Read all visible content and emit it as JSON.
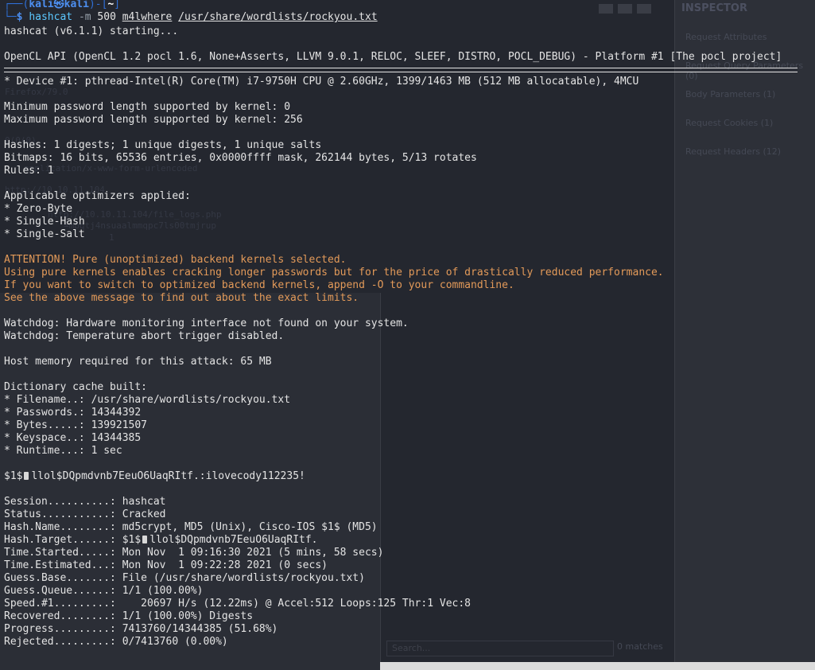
{
  "background_app": {
    "inspector_title": "INSPECTOR",
    "inspector_items": [
      "Request Attributes",
      "Request Query Parameters (0)",
      "Body Parameters (1)",
      "Request Cookies (1)",
      "Request Headers (12)"
    ],
    "ghost_lines": [
      "Firefox/79.0",
      "0(0(0)",
      "application/x-www-form-urlencoded",
      "http://10.10.11.104",
      "http://10.10.11.104/file_logs.php",
      "=mbqtj4nsuaalmmqpc7ls00tmjrup",
      "1"
    ],
    "search_placeholder": "Search...",
    "matches_label": "0 matches"
  },
  "prompt": {
    "frame_top": "┌──(",
    "user": "kali㉿kali",
    "close": ")-[",
    "dir": "~",
    "close2": "]",
    "frame_bottom": "└─",
    "symbol": "$",
    "command": "hashcat",
    "flag": "-m",
    "mode": "500",
    "hash_file": "m4lwhere",
    "wordlist": "/usr/share/wordlists/rockyou.txt"
  },
  "output": {
    "starting": "hashcat (v6.1.1) starting...",
    "opencl": "OpenCL API (OpenCL 1.2 pocl 1.6, None+Asserts, LLVM 9.0.1, RELOC, SLEEF, DISTRO, POCL_DEBUG) - Platform #1 [The pocl project]",
    "device": "* Device #1: pthread-Intel(R) Core(TM) i7-9750H CPU @ 2.60GHz, 1399/1463 MB (512 MB allocatable), 4MCU",
    "min_pw": "Minimum password length supported by kernel: 0",
    "max_pw": "Maximum password length supported by kernel: 256",
    "hashes": "Hashes: 1 digests; 1 unique digests, 1 unique salts",
    "bitmaps": "Bitmaps: 16 bits, 65536 entries, 0x0000ffff mask, 262144 bytes, 5/13 rotates",
    "rules": "Rules: 1",
    "optimizers_title": "Applicable optimizers applied:",
    "opt1": "* Zero-Byte",
    "opt2": "* Single-Hash",
    "opt3": "* Single-Salt",
    "warn1": "ATTENTION! Pure (unoptimized) backend kernels selected.",
    "warn2": "Using pure kernels enables cracking longer passwords but for the price of drastically reduced performance.",
    "warn3": "If you want to switch to optimized backend kernels, append -O to your commandline.",
    "warn4": "See the above message to find out about the exact limits.",
    "watchdog1": "Watchdog: Hardware monitoring interface not found on your system.",
    "watchdog2": "Watchdog: Temperature abort trigger disabled.",
    "host_mem": "Host memory required for this attack: 65 MB",
    "dict_title": "Dictionary cache built:",
    "dict_filename": "* Filename..: /usr/share/wordlists/rockyou.txt",
    "dict_passwords": "* Passwords.: 14344392",
    "dict_bytes": "* Bytes.....: 139921507",
    "dict_keyspace": "* Keyspace..: 14344385",
    "dict_runtime": "* Runtime...: 1 sec",
    "cracked_prefix": "$1$",
    "cracked_rest": "llol$DQpmdvnb7EeuO6UaqRItf.:ilovecody112235!",
    "session": "Session..........: hashcat",
    "status": "Status...........: Cracked",
    "hash_name": "Hash.Name........: md5crypt, MD5 (Unix), Cisco-IOS $1$ (MD5)",
    "hash_target_prefix": "Hash.Target......: $1$",
    "hash_target_rest": "llol$DQpmdvnb7EeuO6UaqRItf.",
    "time_started": "Time.Started.....: Mon Nov  1 09:16:30 2021 (5 mins, 58 secs)",
    "time_estimated": "Time.Estimated...: Mon Nov  1 09:22:28 2021 (0 secs)",
    "guess_base": "Guess.Base.......: File (/usr/share/wordlists/rockyou.txt)",
    "guess_queue": "Guess.Queue......: 1/1 (100.00%)",
    "speed": "Speed.#1.........:    20697 H/s (12.22ms) @ Accel:512 Loops:125 Thr:1 Vec:8",
    "recovered": "Recovered........: 1/1 (100.00%) Digests",
    "progress": "Progress.........: 7413760/14344385 (51.68%)",
    "rejected": "Rejected.........: 0/7413760 (0.00%)"
  }
}
